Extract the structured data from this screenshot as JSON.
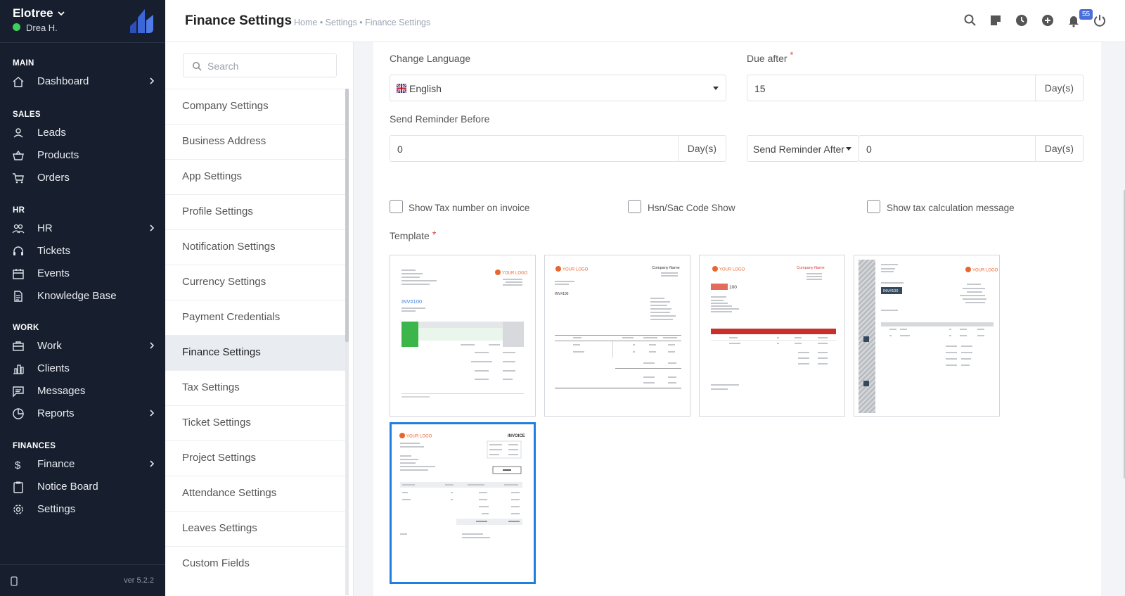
{
  "sidebar": {
    "company": "Elotree",
    "user": "Drea H.",
    "sections": {
      "main": "MAIN",
      "sales": "SALES",
      "hr": "HR",
      "work": "WORK",
      "finances": "FINANCES"
    },
    "items": [
      {
        "label": "Dashboard",
        "icon": "home-icon"
      },
      {
        "label": "Leads",
        "icon": "user-icon"
      },
      {
        "label": "Products",
        "icon": "basket-icon"
      },
      {
        "label": "Orders",
        "icon": "cart-icon"
      },
      {
        "label": "HR",
        "icon": "people-icon"
      },
      {
        "label": "Tickets",
        "icon": "headset-icon"
      },
      {
        "label": "Events",
        "icon": "calendar-icon"
      },
      {
        "label": "Knowledge Base",
        "icon": "document-icon"
      },
      {
        "label": "Work",
        "icon": "briefcase-icon"
      },
      {
        "label": "Clients",
        "icon": "building-icon"
      },
      {
        "label": "Messages",
        "icon": "message-icon"
      },
      {
        "label": "Reports",
        "icon": "pie-chart-icon"
      },
      {
        "label": "Finance",
        "icon": "dollar-icon"
      },
      {
        "label": "Notice Board",
        "icon": "clipboard-icon"
      },
      {
        "label": "Settings",
        "icon": "gear-icon"
      }
    ],
    "version": "ver 5.2.2"
  },
  "header": {
    "title": "Finance Settings",
    "breadcrumb": "Home • Settings • Finance Settings",
    "notification_count": "55"
  },
  "settings_menu": {
    "search_placeholder": "Search",
    "items": [
      "Company Settings",
      "Business Address",
      "App Settings",
      "Profile Settings",
      "Notification Settings",
      "Currency Settings",
      "Payment Credentials",
      "Finance Settings",
      "Tax Settings",
      "Ticket Settings",
      "Project Settings",
      "Attendance Settings",
      "Leaves Settings",
      "Custom Fields"
    ],
    "active": "Finance Settings"
  },
  "form": {
    "change_language_label": "Change Language",
    "language_value": "English",
    "due_after_label": "Due after",
    "due_after_value": "15",
    "days_addon": "Day(s)",
    "send_reminder_before_label": "Send Reminder Before",
    "send_reminder_before_value": "0",
    "send_reminder_after_select": "Send Reminder After",
    "send_reminder_after_value": "0",
    "show_tax_number": "Show Tax number on invoice",
    "hsn_sac_code": "Hsn/Sac Code Show",
    "show_tax_calc": "Show tax calculation message",
    "template_label": "Template"
  },
  "templates": [
    {
      "logo": "YOUR LOGO",
      "invoice_no": "INV#100",
      "accent": "#3cb54a"
    },
    {
      "logo": "YOUR LOGO",
      "company": "Company Name",
      "invoice_no": "INV#100",
      "accent": "#333333"
    },
    {
      "logo": "YOUR LOGO",
      "company": "Company Name",
      "invoice_no": "100",
      "accent": "#d43a3a"
    },
    {
      "logo": "YOUR LOGO",
      "invoice_no": "INV#100",
      "accent": "#34495e"
    },
    {
      "logo": "YOUR LOGO",
      "heading": "INVOICE",
      "accent": "#1f7fe0"
    }
  ],
  "colors": {
    "sidebar_bg": "#171f2e",
    "online": "#3ecf5c",
    "selected_template": "#1f7fe0",
    "required": "#e03a3a",
    "badge": "#4a6fd8"
  }
}
